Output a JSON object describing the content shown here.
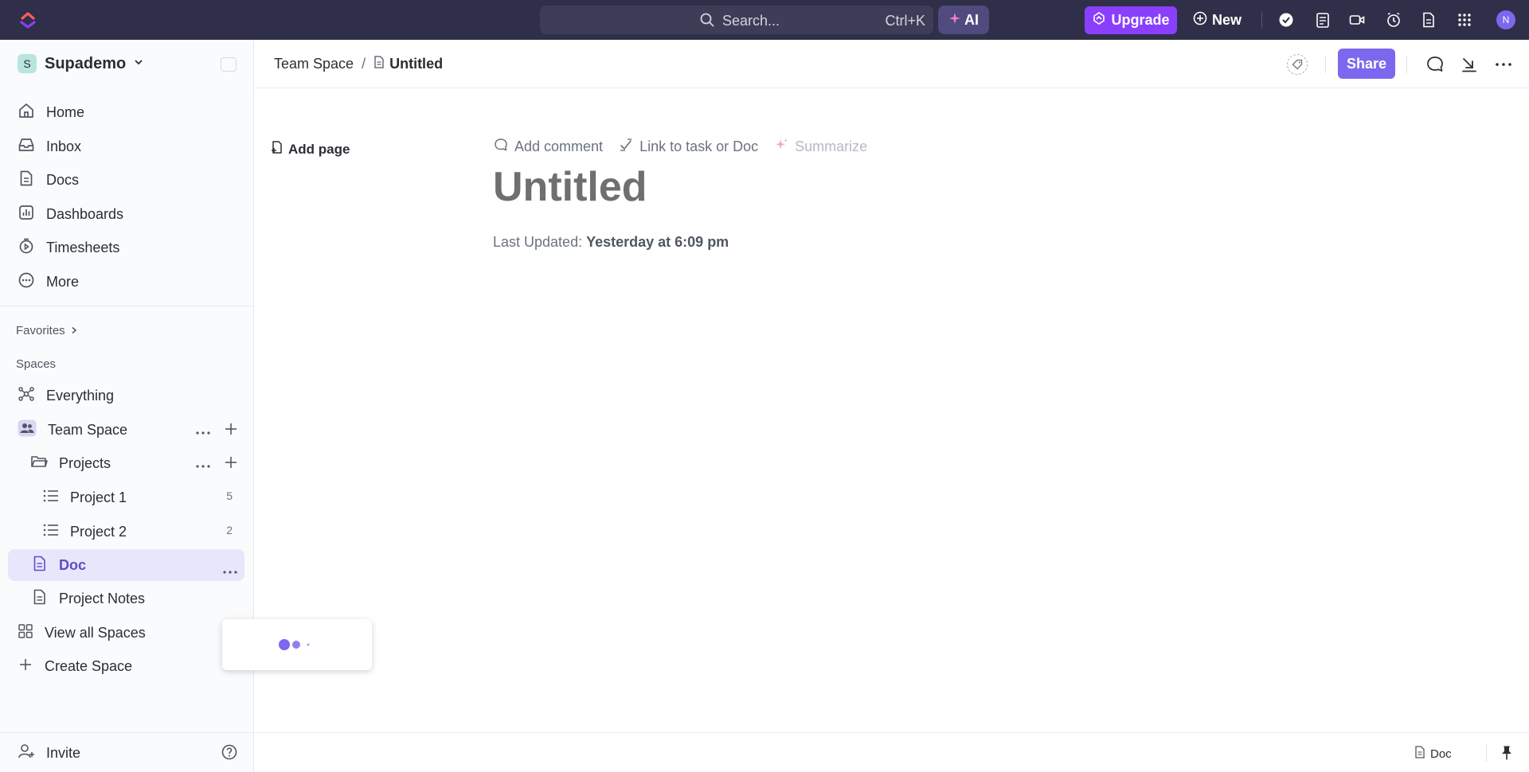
{
  "topbar": {
    "search_placeholder": "Search...",
    "search_shortcut": "Ctrl+K",
    "ai_label": "AI",
    "upgrade_label": "Upgrade",
    "new_label": "New",
    "avatar_initial": "N",
    "accent": "#7b68ee",
    "bg": "#2f2f49"
  },
  "workspace": {
    "badge": "S",
    "name": "Supademo"
  },
  "sidebar": {
    "nav": [
      {
        "label": "Home",
        "icon": "home-icon"
      },
      {
        "label": "Inbox",
        "icon": "inbox-icon"
      },
      {
        "label": "Docs",
        "icon": "docs-icon"
      },
      {
        "label": "Dashboards",
        "icon": "dashboards-icon"
      },
      {
        "label": "Timesheets",
        "icon": "timesheets-icon"
      },
      {
        "label": "More",
        "icon": "more-icon"
      }
    ],
    "favorites_label": "Favorites",
    "spaces_label": "Spaces",
    "everything_label": "Everything",
    "team_space_label": "Team Space",
    "projects_label": "Projects",
    "project1_label": "Project 1",
    "project1_count": "5",
    "project2_label": "Project 2",
    "project2_count": "2",
    "doc_label": "Doc",
    "project_notes_label": "Project Notes",
    "view_all_label": "View all Spaces",
    "create_space_label": "Create Space",
    "invite_label": "Invite"
  },
  "header": {
    "crumb_parent": "Team Space",
    "crumb_current": "Untitled",
    "share_label": "Share"
  },
  "content": {
    "add_page_label": "Add page",
    "add_comment_label": "Add comment",
    "link_label": "Link to task or Doc",
    "summarize_label": "Summarize",
    "title": "Untitled",
    "last_updated_label": "Last Updated:",
    "last_updated_value": "Yesterday at 6:09 pm"
  },
  "footer": {
    "doc_label": "Doc"
  }
}
